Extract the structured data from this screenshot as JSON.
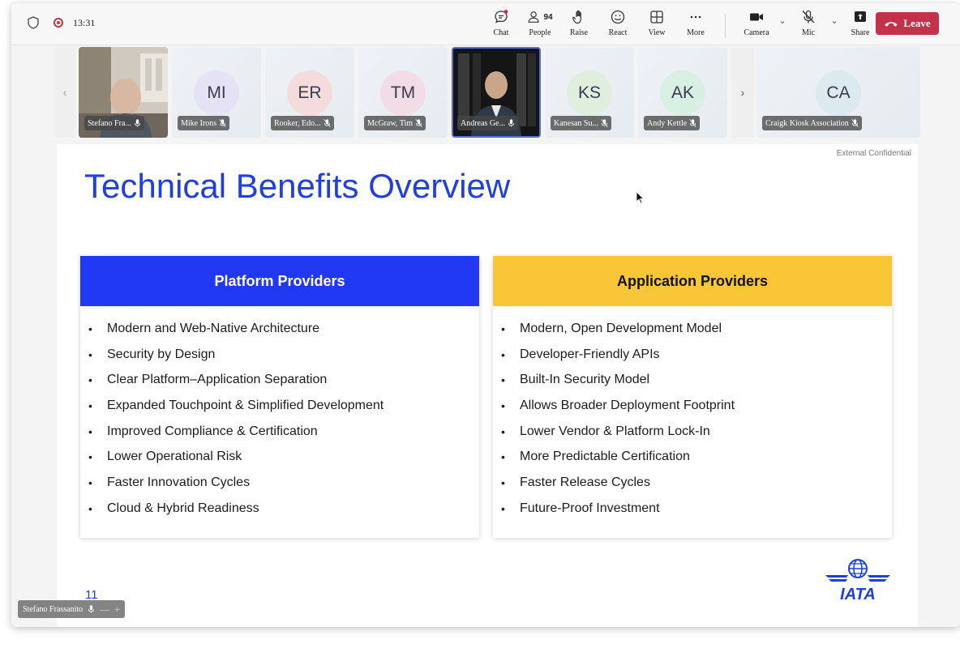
{
  "status": {
    "time": "13:31"
  },
  "toolbar": {
    "chat": "Chat",
    "people": "People",
    "people_count": "94",
    "raise": "Raise",
    "react": "React",
    "view": "View",
    "more": "More",
    "camera": "Camera",
    "mic": "Mic",
    "share": "Share",
    "leave": "Leave"
  },
  "participants": [
    {
      "name": "Stefano Fra...",
      "initials": "",
      "type": "video"
    },
    {
      "name": "Mike Irons",
      "initials": "MI",
      "avatar_color": "#e4e2f4"
    },
    {
      "name": "Rooker, Edo...",
      "initials": "ER",
      "avatar_color": "#f5dcdc"
    },
    {
      "name": "McGraw, Tim",
      "initials": "TM",
      "avatar_color": "#f2dce6"
    },
    {
      "name": "Andreas Ge...",
      "initials": "",
      "type": "video"
    },
    {
      "name": "Kanesan Su...",
      "initials": "KS",
      "avatar_color": "#dfeedd"
    },
    {
      "name": "Andy Kettle",
      "initials": "AK",
      "avatar_color": "#d8efe4"
    },
    {
      "name": "Craigk Kiosk Association",
      "initials": "CA",
      "avatar_color": "#dceaf0"
    }
  ],
  "slide": {
    "confidential": "External Confidential",
    "title": "Technical Benefits Overview",
    "left_header": "Platform Providers",
    "left_items": [
      "Modern and Web-Native Architecture",
      "Security by Design",
      "Clear Platform–Application Separation",
      "Expanded Touchpoint & Simplified Development",
      "Improved Compliance & Certification",
      "Lower Operational Risk",
      "Faster Innovation Cycles",
      "Cloud & Hybrid Readiness"
    ],
    "right_header": "Application Providers",
    "right_items": [
      "Modern, Open Development Model",
      "Developer-Friendly APIs",
      "Built-In Security Model",
      "Allows Broader Deployment Footprint",
      "Lower Vendor & Platform Lock-In",
      "More Predictable Certification",
      "Faster Release Cycles",
      "Future-Proof Investment"
    ],
    "page_number": "11",
    "logo_text": "IATA"
  },
  "self_view": {
    "name": "Stefano Frassanito"
  },
  "colors": {
    "accent_blue": "#2139f2",
    "accent_yellow": "#f8c637",
    "leave_red": "#c4314b",
    "title_blue": "#1f3fe0"
  }
}
